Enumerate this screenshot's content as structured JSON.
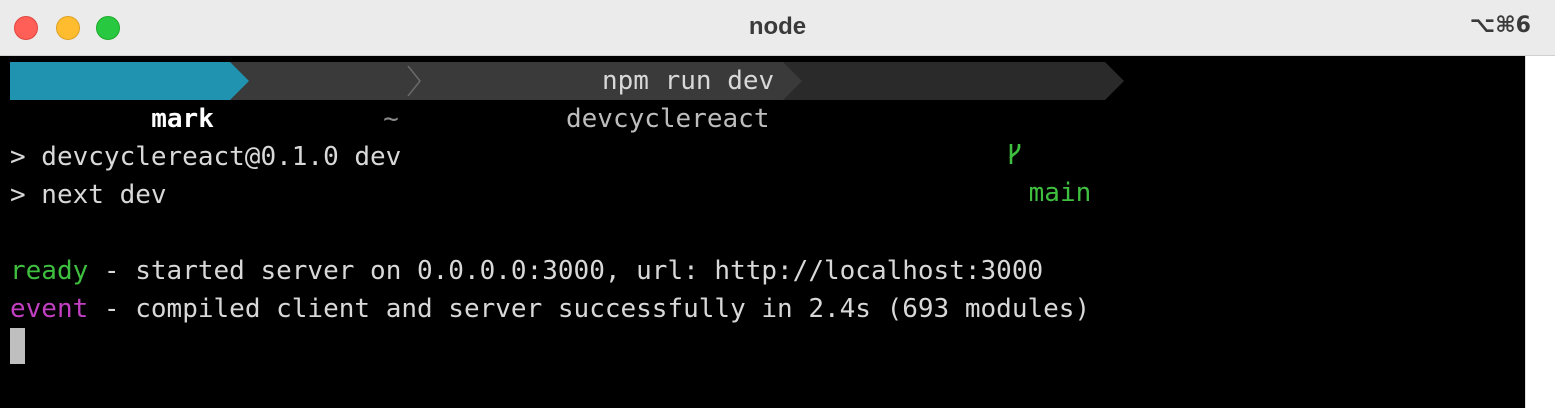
{
  "window": {
    "title": "node",
    "shortcut": "⌥⌘6"
  },
  "colors": {
    "user_segment": "#1f93b0",
    "path_segment": "#3a3a3a",
    "git_segment": "#2a2a2a",
    "ready": "#3fbf3f",
    "event": "#c23fc2"
  },
  "prompt": {
    "user": "mark",
    "home": "~",
    "directory": "devcyclereact",
    "branch_icon": "git-branch-icon",
    "branch": "main",
    "command": "npm run dev"
  },
  "output": {
    "line1": "> devcyclereact@0.1.0 dev",
    "line2": "> next dev",
    "ready_tag": "ready",
    "ready_text": " - started server on 0.0.0.0:3000, url: http://localhost:3000",
    "event_tag": "event",
    "event_text": " - compiled client and server successfully in 2.4s (693 modules)"
  }
}
